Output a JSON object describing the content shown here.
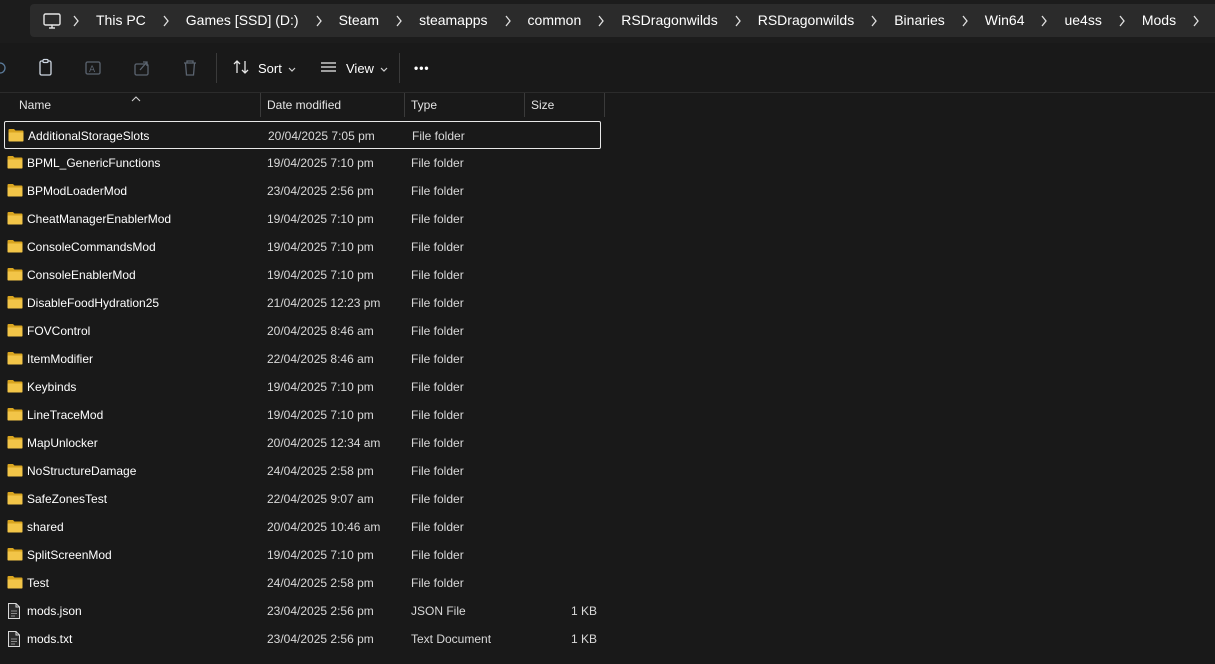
{
  "breadcrumb": [
    "This PC",
    "Games [SSD] (D:)",
    "Steam",
    "steamapps",
    "common",
    "RSDragonwilds",
    "RSDragonwilds",
    "Binaries",
    "Win64",
    "ue4ss",
    "Mods"
  ],
  "toolbar": {
    "sort_label": "Sort",
    "view_label": "View",
    "more_label": "•••"
  },
  "columns": {
    "name": "Name",
    "date": "Date modified",
    "type": "Type",
    "size": "Size"
  },
  "files": [
    {
      "name": "AdditionalStorageSlots",
      "date": "20/04/2025 7:05 pm",
      "type": "File folder",
      "size": "",
      "kind": "folder"
    },
    {
      "name": "BPML_GenericFunctions",
      "date": "19/04/2025 7:10 pm",
      "type": "File folder",
      "size": "",
      "kind": "folder"
    },
    {
      "name": "BPModLoaderMod",
      "date": "23/04/2025 2:56 pm",
      "type": "File folder",
      "size": "",
      "kind": "folder"
    },
    {
      "name": "CheatManagerEnablerMod",
      "date": "19/04/2025 7:10 pm",
      "type": "File folder",
      "size": "",
      "kind": "folder"
    },
    {
      "name": "ConsoleCommandsMod",
      "date": "19/04/2025 7:10 pm",
      "type": "File folder",
      "size": "",
      "kind": "folder"
    },
    {
      "name": "ConsoleEnablerMod",
      "date": "19/04/2025 7:10 pm",
      "type": "File folder",
      "size": "",
      "kind": "folder"
    },
    {
      "name": "DisableFoodHydration25",
      "date": "21/04/2025 12:23 pm",
      "type": "File folder",
      "size": "",
      "kind": "folder"
    },
    {
      "name": "FOVControl",
      "date": "20/04/2025 8:46 am",
      "type": "File folder",
      "size": "",
      "kind": "folder"
    },
    {
      "name": "ItemModifier",
      "date": "22/04/2025 8:46 am",
      "type": "File folder",
      "size": "",
      "kind": "folder"
    },
    {
      "name": "Keybinds",
      "date": "19/04/2025 7:10 pm",
      "type": "File folder",
      "size": "",
      "kind": "folder"
    },
    {
      "name": "LineTraceMod",
      "date": "19/04/2025 7:10 pm",
      "type": "File folder",
      "size": "",
      "kind": "folder"
    },
    {
      "name": "MapUnlocker",
      "date": "20/04/2025 12:34 am",
      "type": "File folder",
      "size": "",
      "kind": "folder"
    },
    {
      "name": "NoStructureDamage",
      "date": "24/04/2025 2:58 pm",
      "type": "File folder",
      "size": "",
      "kind": "folder"
    },
    {
      "name": "SafeZonesTest",
      "date": "22/04/2025 9:07 am",
      "type": "File folder",
      "size": "",
      "kind": "folder"
    },
    {
      "name": "shared",
      "date": "20/04/2025 10:46 am",
      "type": "File folder",
      "size": "",
      "kind": "folder"
    },
    {
      "name": "SplitScreenMod",
      "date": "19/04/2025 7:10 pm",
      "type": "File folder",
      "size": "",
      "kind": "folder"
    },
    {
      "name": "Test",
      "date": "24/04/2025 2:58 pm",
      "type": "File folder",
      "size": "",
      "kind": "folder"
    },
    {
      "name": "mods.json",
      "date": "23/04/2025 2:56 pm",
      "type": "JSON File",
      "size": "1 KB",
      "kind": "file"
    },
    {
      "name": "mods.txt",
      "date": "23/04/2025 2:56 pm",
      "type": "Text Document",
      "size": "1 KB",
      "kind": "file"
    }
  ],
  "selected_index": 0,
  "colors": {
    "folder": "#f2c548",
    "folder_dark": "#d9a520",
    "background": "#191919",
    "address_bg": "#2b2b2b"
  }
}
